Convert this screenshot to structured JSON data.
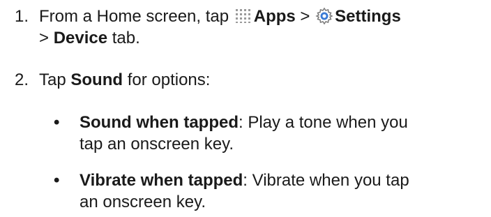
{
  "steps": [
    {
      "number": "1.",
      "line1_prefix": "From a Home screen, tap ",
      "apps_label": "Apps",
      "sep1": " > ",
      "settings_label": "Settings",
      "line2_prefix": "> ",
      "device_label": "Device",
      "line2_suffix": " tab.",
      "apps_icon": "apps-grid-icon",
      "settings_icon": "settings-gear-icon"
    },
    {
      "number": "2.",
      "prefix": "Tap ",
      "sound_label": "Sound",
      "suffix": " for options:"
    }
  ],
  "bullets": [
    {
      "dot": "•",
      "term": "Sound when tapped",
      "colon": ":",
      "line1": " Play a tone when you",
      "line2": "tap an onscreen key."
    },
    {
      "dot": "•",
      "term": "Vibrate when tapped",
      "colon": ":",
      "line1": " Vibrate when you tap",
      "line2": "an onscreen key."
    }
  ],
  "colors": {
    "text": "#1a1a1a",
    "icon_grid": "#9a9a9a",
    "icon_gear_blue": "#3a7bd5"
  }
}
